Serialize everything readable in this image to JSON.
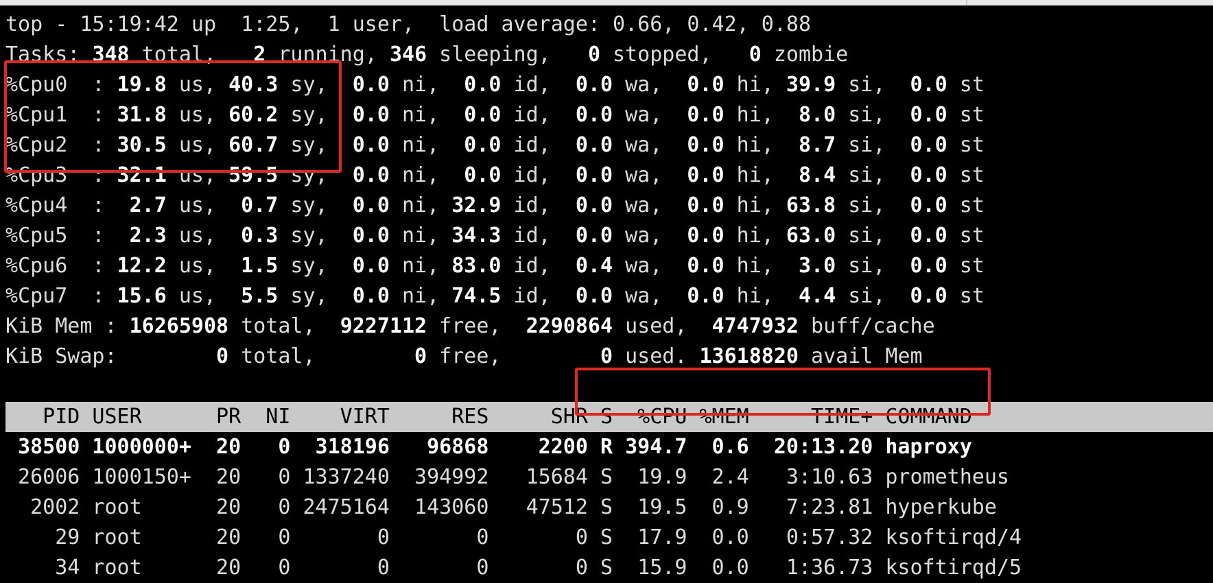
{
  "window": {
    "title": ""
  },
  "summary": {
    "uptime": [
      "top - 15:19:42 up  1:25,  1 user,  load average: 0.66, 0.42, 0.88"
    ],
    "tasks": [
      {
        "t": "Tasks: ",
        "b": false
      },
      {
        "t": "348",
        "b": true
      },
      {
        "t": " total,   ",
        "b": false
      },
      {
        "t": "2",
        "b": true
      },
      {
        "t": " running, ",
        "b": false
      },
      {
        "t": "346",
        "b": true
      },
      {
        "t": " sleeping,   ",
        "b": false
      },
      {
        "t": "0",
        "b": true
      },
      {
        "t": " stopped,   ",
        "b": false
      },
      {
        "t": "0",
        "b": true
      },
      {
        "t": " zombie",
        "b": false
      }
    ],
    "cpus": [
      {
        "label": "%Cpu0",
        "us": "19.8",
        "sy": "40.3",
        "ni": "0.0",
        "id": "0.0",
        "wa": "0.0",
        "hi": "0.0",
        "si": "39.9",
        "st": "0.0"
      },
      {
        "label": "%Cpu1",
        "us": "31.8",
        "sy": "60.2",
        "ni": "0.0",
        "id": "0.0",
        "wa": "0.0",
        "hi": "0.0",
        "si": "8.0",
        "st": "0.0"
      },
      {
        "label": "%Cpu2",
        "us": "30.5",
        "sy": "60.7",
        "ni": "0.0",
        "id": "0.0",
        "wa": "0.0",
        "hi": "0.0",
        "si": "8.7",
        "st": "0.0"
      },
      {
        "label": "%Cpu3",
        "us": "32.1",
        "sy": "59.5",
        "ni": "0.0",
        "id": "0.0",
        "wa": "0.0",
        "hi": "0.0",
        "si": "8.4",
        "st": "0.0"
      },
      {
        "label": "%Cpu4",
        "us": "2.7",
        "sy": "0.7",
        "ni": "0.0",
        "id": "32.9",
        "wa": "0.0",
        "hi": "0.0",
        "si": "63.8",
        "st": "0.0"
      },
      {
        "label": "%Cpu5",
        "us": "2.3",
        "sy": "0.3",
        "ni": "0.0",
        "id": "34.3",
        "wa": "0.0",
        "hi": "0.0",
        "si": "63.0",
        "st": "0.0"
      },
      {
        "label": "%Cpu6",
        "us": "12.2",
        "sy": "1.5",
        "ni": "0.0",
        "id": "83.0",
        "wa": "0.4",
        "hi": "0.0",
        "si": "3.0",
        "st": "0.0"
      },
      {
        "label": "%Cpu7",
        "us": "15.6",
        "sy": "5.5",
        "ni": "0.0",
        "id": "74.5",
        "wa": "0.0",
        "hi": "0.0",
        "si": "4.4",
        "st": "0.0"
      }
    ],
    "mem": [
      {
        "t": "KiB Mem : ",
        "b": false
      },
      {
        "t": "16265908",
        "b": true
      },
      {
        "t": " total,  ",
        "b": false
      },
      {
        "t": "9227112",
        "b": true
      },
      {
        "t": " free,  ",
        "b": false
      },
      {
        "t": "2290864",
        "b": true
      },
      {
        "t": " used,  ",
        "b": false
      },
      {
        "t": "4747932",
        "b": true
      },
      {
        "t": " buff/cache",
        "b": false
      }
    ],
    "swap": [
      {
        "t": "KiB Swap:        ",
        "b": false
      },
      {
        "t": "0",
        "b": true
      },
      {
        "t": " total,        ",
        "b": false
      },
      {
        "t": "0",
        "b": true
      },
      {
        "t": " free,        ",
        "b": false
      },
      {
        "t": "0",
        "b": true
      },
      {
        "t": " used. ",
        "b": false
      },
      {
        "t": "13618820",
        "b": true
      },
      {
        "t": " avail Mem",
        "b": false
      }
    ]
  },
  "process_table": {
    "headers": [
      "PID",
      "USER",
      "PR",
      "NI",
      "VIRT",
      "RES",
      "SHR",
      "S",
      "%CPU",
      "%MEM",
      "TIME+",
      "COMMAND"
    ],
    "rows": [
      {
        "pid": "38500",
        "user": "1000000+",
        "pr": "20",
        "ni": "0",
        "virt": "318196",
        "res": "96868",
        "shr": "2200",
        "s": "R",
        "cpu": "394.7",
        "mem": "0.6",
        "time": "20:13.20",
        "command": "haproxy"
      },
      {
        "pid": "26006",
        "user": "1000150+",
        "pr": "20",
        "ni": "0",
        "virt": "1337240",
        "res": "394992",
        "shr": "15684",
        "s": "S",
        "cpu": "19.9",
        "mem": "2.4",
        "time": "3:10.63",
        "command": "prometheus"
      },
      {
        "pid": "2002",
        "user": "root",
        "pr": "20",
        "ni": "0",
        "virt": "2475164",
        "res": "143060",
        "shr": "47512",
        "s": "S",
        "cpu": "19.5",
        "mem": "0.9",
        "time": "7:23.81",
        "command": "hyperkube"
      },
      {
        "pid": "29",
        "user": "root",
        "pr": "20",
        "ni": "0",
        "virt": "0",
        "res": "0",
        "shr": "0",
        "s": "S",
        "cpu": "17.9",
        "mem": "0.0",
        "time": "0:57.32",
        "command": "ksoftirqd/4"
      },
      {
        "pid": "34",
        "user": "root",
        "pr": "20",
        "ni": "0",
        "virt": "0",
        "res": "0",
        "shr": "0",
        "s": "S",
        "cpu": "15.9",
        "mem": "0.0",
        "time": "1:36.73",
        "command": "ksoftirqd/5"
      }
    ]
  },
  "highlight_color": "#e1261c"
}
